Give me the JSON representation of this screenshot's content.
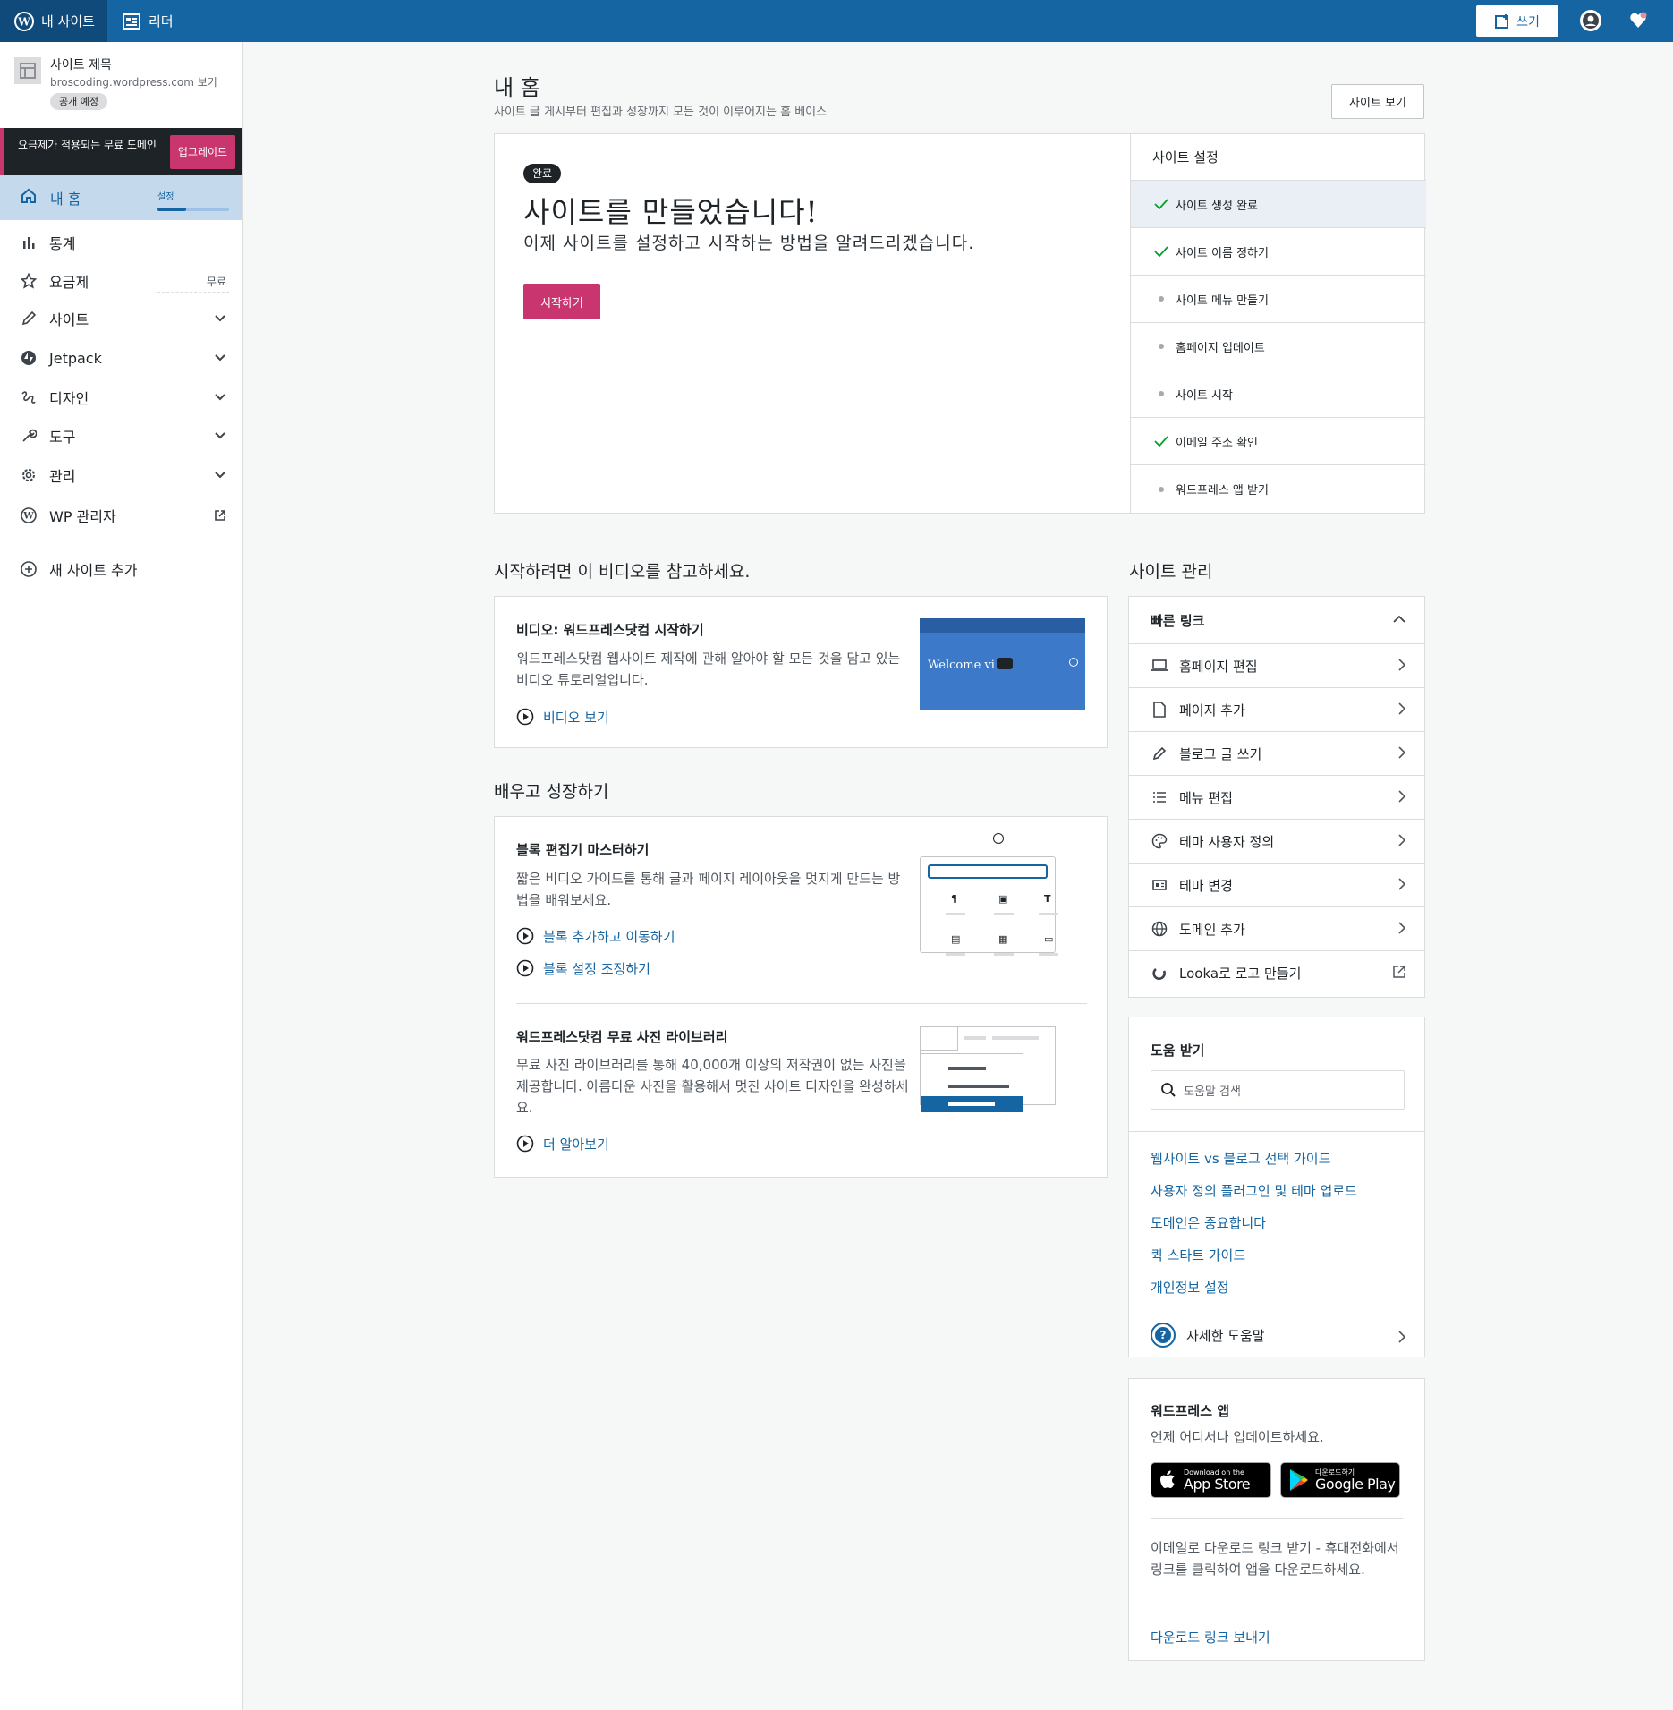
{
  "topbar": {
    "my_site": "내 사이트",
    "reader": "리더",
    "write": "쓰기",
    "colors": {
      "bar": "#1565a2",
      "active": "#0f4a7a"
    }
  },
  "sidebar": {
    "site_title": "사이트 제목",
    "site_url": "broscoding.wordpress.com",
    "site_url_view": "보기",
    "site_badge": "공개 예정",
    "upsell_text": "요금제가 적용되는 무료 도메인",
    "upsell_button": "업그레이드",
    "home": {
      "label": "내 홈",
      "progress_label": "설정",
      "progress": 0.4
    },
    "items": [
      {
        "label": "통계",
        "icon": "stats-icon"
      },
      {
        "label": "요금제",
        "icon": "star-icon",
        "right": "무료"
      },
      {
        "label": "사이트",
        "icon": "pencil-icon"
      },
      {
        "label": "Jetpack",
        "icon": "jetpack-icon"
      },
      {
        "label": "디자인",
        "icon": "design-icon"
      },
      {
        "label": "도구",
        "icon": "tools-icon"
      },
      {
        "label": "관리",
        "icon": "gear-icon"
      },
      {
        "label": "WP 관리자",
        "icon": "wordpress-icon"
      },
      {
        "label": "새 사이트 추가",
        "icon": "plus-circle-icon"
      }
    ]
  },
  "main": {
    "title": "내 홈",
    "subtitle": "사이트 글 게시부터 편집과 성장까지 모든 것이 이루어지는 홈 베이스",
    "view_site": "사이트 보기",
    "launch": {
      "badge": "완료",
      "heading": "사이트를 만들었습니다!",
      "desc": "이제 사이트를 설정하고 시작하는 방법을 알려드리겠습니다.",
      "button": "시작하기"
    },
    "checklist": {
      "title": "사이트 설정",
      "items": [
        {
          "label": "사이트 생성 완료",
          "done": true
        },
        {
          "label": "사이트 이름 정하기",
          "done": true
        },
        {
          "label": "사이트 메뉴 만들기",
          "done": false
        },
        {
          "label": "홈페이지 업데이트",
          "done": false
        },
        {
          "label": "사이트 시작",
          "done": false
        },
        {
          "label": "이메일 주소 확인",
          "done": true
        },
        {
          "label": "워드프레스 앱 받기",
          "done": false
        }
      ]
    },
    "video_section": {
      "heading": "시작하려면 이 비디오를 참고하세요.",
      "title": "비디오: 워드프레스닷컴 시작하기",
      "desc": "워드프레스닷컴 웹사이트 제작에 관해 알아야 할 모든 것을 담고 있는 비디오 튜토리얼입니다.",
      "link": "비디오 보기",
      "thumb_text": "Welcome vi"
    },
    "learn_section": {
      "heading": "배우고 성장하기",
      "block_title": "블록 편집기 마스터하기",
      "block_desc": "짧은 비디오 가이드를 통해 글과 페이지 레이아웃을 멋지게 만드는 방법을 배워보세요.",
      "block_link1": "블록 추가하고 이동하기",
      "block_link2": "블록 설정 조정하기",
      "photo_title": "워드프레스닷컴 무료 사진 라이브러리",
      "photo_desc": "무료 사진 라이브러리를 통해 40,000개 이상의 저작권이 없는 사진을 제공합니다. 아름다운 사진을 활용해서 멋진 사이트 디자인을 완성하세요.",
      "photo_link": "더 알아보기"
    }
  },
  "right": {
    "heading": "사이트 관리",
    "quick_links": {
      "title": "빠른 링크",
      "items": [
        {
          "label": "홈페이지 편집",
          "icon": "laptop-icon",
          "external": false
        },
        {
          "label": "페이지 추가",
          "icon": "page-icon",
          "external": false
        },
        {
          "label": "블로그 글 쓰기",
          "icon": "pencil-icon",
          "external": false
        },
        {
          "label": "메뉴 편집",
          "icon": "list-icon",
          "external": false
        },
        {
          "label": "테마 사용자 정의",
          "icon": "palette-icon",
          "external": false
        },
        {
          "label": "테마 변경",
          "icon": "theme-icon",
          "external": false
        },
        {
          "label": "도메인 추가",
          "icon": "globe-icon",
          "external": false
        },
        {
          "label": "Looka로 로고 만들기",
          "icon": "looka-icon",
          "external": true
        }
      ]
    },
    "help": {
      "title": "도움 받기",
      "search_placeholder": "도움말 검색",
      "links": [
        "웹사이트 vs 블로그 선택 가이드",
        "사용자 정의 플러그인 및 테마 업로드",
        "도메인은 중요합니다",
        "퀵 스타트 가이드",
        "개인정보 설정"
      ],
      "more": "자세한 도움말"
    },
    "app": {
      "title": "워드프레스 앱",
      "subtitle": "언제 어디서나 업데이트하세요.",
      "appstore_small": "Download on the",
      "appstore_big": "App Store",
      "googleplay_small": "다운로드하기",
      "googleplay_big": "Google Play",
      "desc": "이메일로 다운로드 링크 받기 - 휴대전화에서 링크를 클릭하여 앱을 다운로드하세요.",
      "link": "다운로드 링크 보내기"
    }
  }
}
